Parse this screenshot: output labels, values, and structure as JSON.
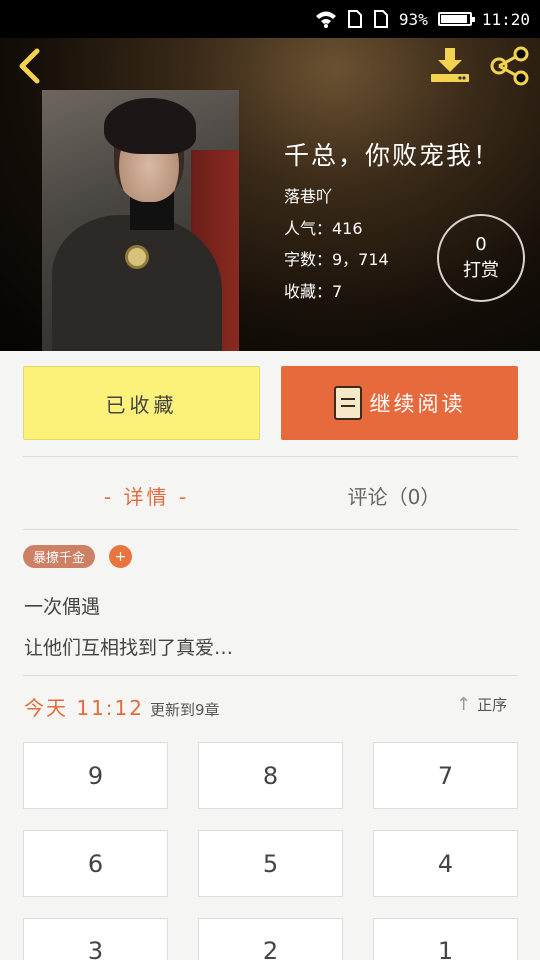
{
  "status_bar": {
    "battery_percent": "93%",
    "battery_level": 0.93,
    "time": "11:20",
    "icons": [
      "wifi-icon",
      "sim1-icon",
      "sim2-icon",
      "battery-icon"
    ]
  },
  "header": {
    "back_icon": "chevron-left-icon",
    "download_icon": "download-icon",
    "share_icon": "share-icon",
    "accent_color": "#f2d24f"
  },
  "book": {
    "title": "千总，你败宠我！",
    "author": "落巷吖",
    "popularity": "人气：416",
    "word_count": "字数：9，714",
    "favorites": "收藏：7",
    "tip": {
      "count": "0",
      "label": "打赏"
    }
  },
  "actions": {
    "collected_label": "已收藏",
    "continue_label": "继续阅读",
    "collected_color": "#fcf27a",
    "continue_color": "#e66a3c"
  },
  "tabs": [
    {
      "label": "- 详情 -",
      "active": true
    },
    {
      "label": "评论（0）",
      "active": false
    }
  ],
  "tags": {
    "items": [
      "暴撩千金"
    ],
    "add_label": "+"
  },
  "description": [
    "一次偶遇",
    "让他们互相找到了真爱…"
  ],
  "updates": {
    "time": "今天 11:12",
    "text": "更新到9章",
    "sort_label": "正序"
  },
  "chapters": [
    "9",
    "8",
    "7",
    "6",
    "5",
    "4",
    "3",
    "2",
    "1"
  ]
}
